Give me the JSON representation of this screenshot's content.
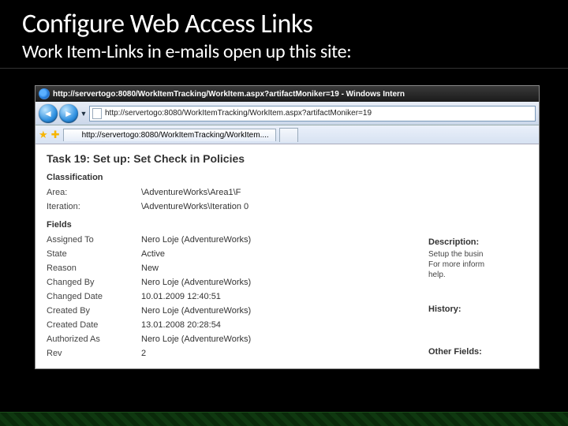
{
  "slide": {
    "title": "Configure Web Access Links",
    "subtitle": "Work Item-Links in e-mails open up this site:"
  },
  "titlebar": {
    "text": "http://servertogo:8080/WorkItemTracking/WorkItem.aspx?artifactMoniker=19 - Windows Intern"
  },
  "address": {
    "url": "http://servertogo:8080/WorkItemTracking/WorkItem.aspx?artifactMoniker=19"
  },
  "tab": {
    "label": "http://servertogo:8080/WorkItemTracking/WorkItem...."
  },
  "workitem": {
    "title": "Task 19: Set up: Set Check in Policies",
    "sections": {
      "classification": "Classification",
      "fields": "Fields",
      "description": "Description:",
      "history": "History:",
      "other": "Other Fields:"
    },
    "classification": {
      "area_label": "Area:",
      "area_value": "\\AdventureWorks\\Area1\\F",
      "iteration_label": "Iteration:",
      "iteration_value": "\\AdventureWorks\\Iteration 0"
    },
    "fields": {
      "assigned_label": "Assigned To",
      "assigned_value": "Nero Loje (AdventureWorks)",
      "state_label": "State",
      "state_value": "Active",
      "reason_label": "Reason",
      "reason_value": "New",
      "changedby_label": "Changed By",
      "changedby_value": "Nero Loje (AdventureWorks)",
      "changeddate_label": "Changed Date",
      "changeddate_value": "10.01.2009 12:40:51",
      "createdby_label": "Created By",
      "createdby_value": "Nero Loje (AdventureWorks)",
      "createddate_label": "Created Date",
      "createddate_value": "13.01.2008 20:28:54",
      "authas_label": "Authorized As",
      "authas_value": "Nero Loje (AdventureWorks)",
      "rev_label": "Rev",
      "rev_value": "2"
    },
    "description": {
      "line1": "Setup the busin",
      "line2": "For more inform",
      "line3": "help."
    }
  }
}
